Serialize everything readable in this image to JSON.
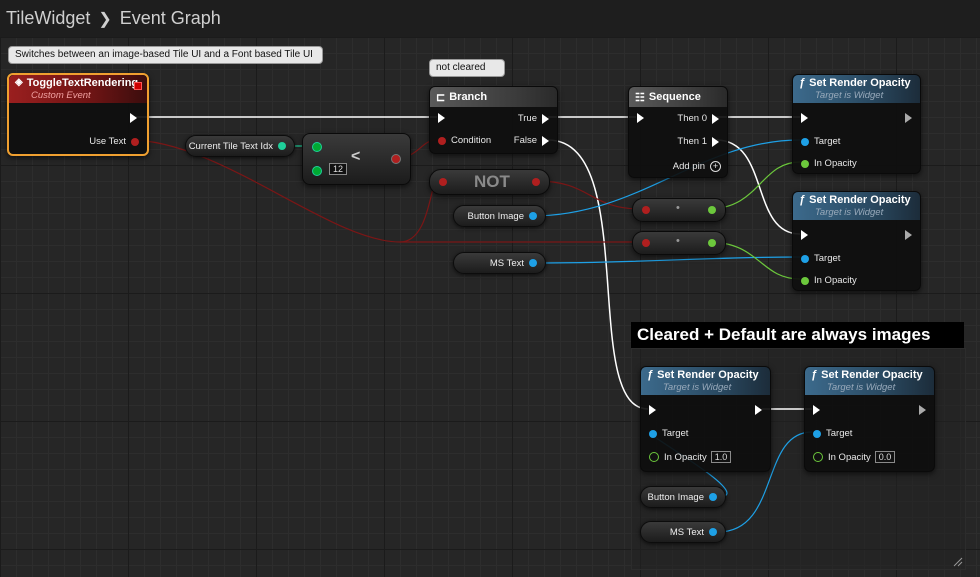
{
  "breadcrumb": {
    "asset": "TileWidget",
    "graph": "Event Graph"
  },
  "comments": {
    "top_bubble": "Switches between an image-based Tile UI and a Font based Tile UI",
    "branch_bubble": "not cleared",
    "group_title": "Cleared + Default are always images"
  },
  "event_node": {
    "title": "ToggleTextRendering",
    "subtitle": "Custom Event",
    "pin_use_text": "Use Text"
  },
  "var_current_tile": "Current Tile Text Idx",
  "less_node": {
    "op": "<",
    "const": "12"
  },
  "branch": {
    "title": "Branch",
    "condition": "Condition",
    "true": "True",
    "false": "False"
  },
  "not_node": "NOT",
  "var_button_image": "Button Image",
  "var_ms_text": "MS Text",
  "sequence": {
    "title": "Sequence",
    "then0": "Then 0",
    "then1": "Then 1",
    "add_pin": "Add pin"
  },
  "set_opacity": {
    "title": "Set Render Opacity",
    "subtitle": "Target is Widget",
    "target": "Target",
    "in_opacity": "In Opacity",
    "val1": "1.0",
    "val2": "0.0"
  },
  "select_node": {
    "label": "•"
  },
  "colors": {
    "exec": "#ffffff",
    "bool": "#9b1d1d",
    "int": "#1fcf9a",
    "object": "#1ea0e6",
    "float": "#8ae04a",
    "event_border": "#f0a030"
  }
}
